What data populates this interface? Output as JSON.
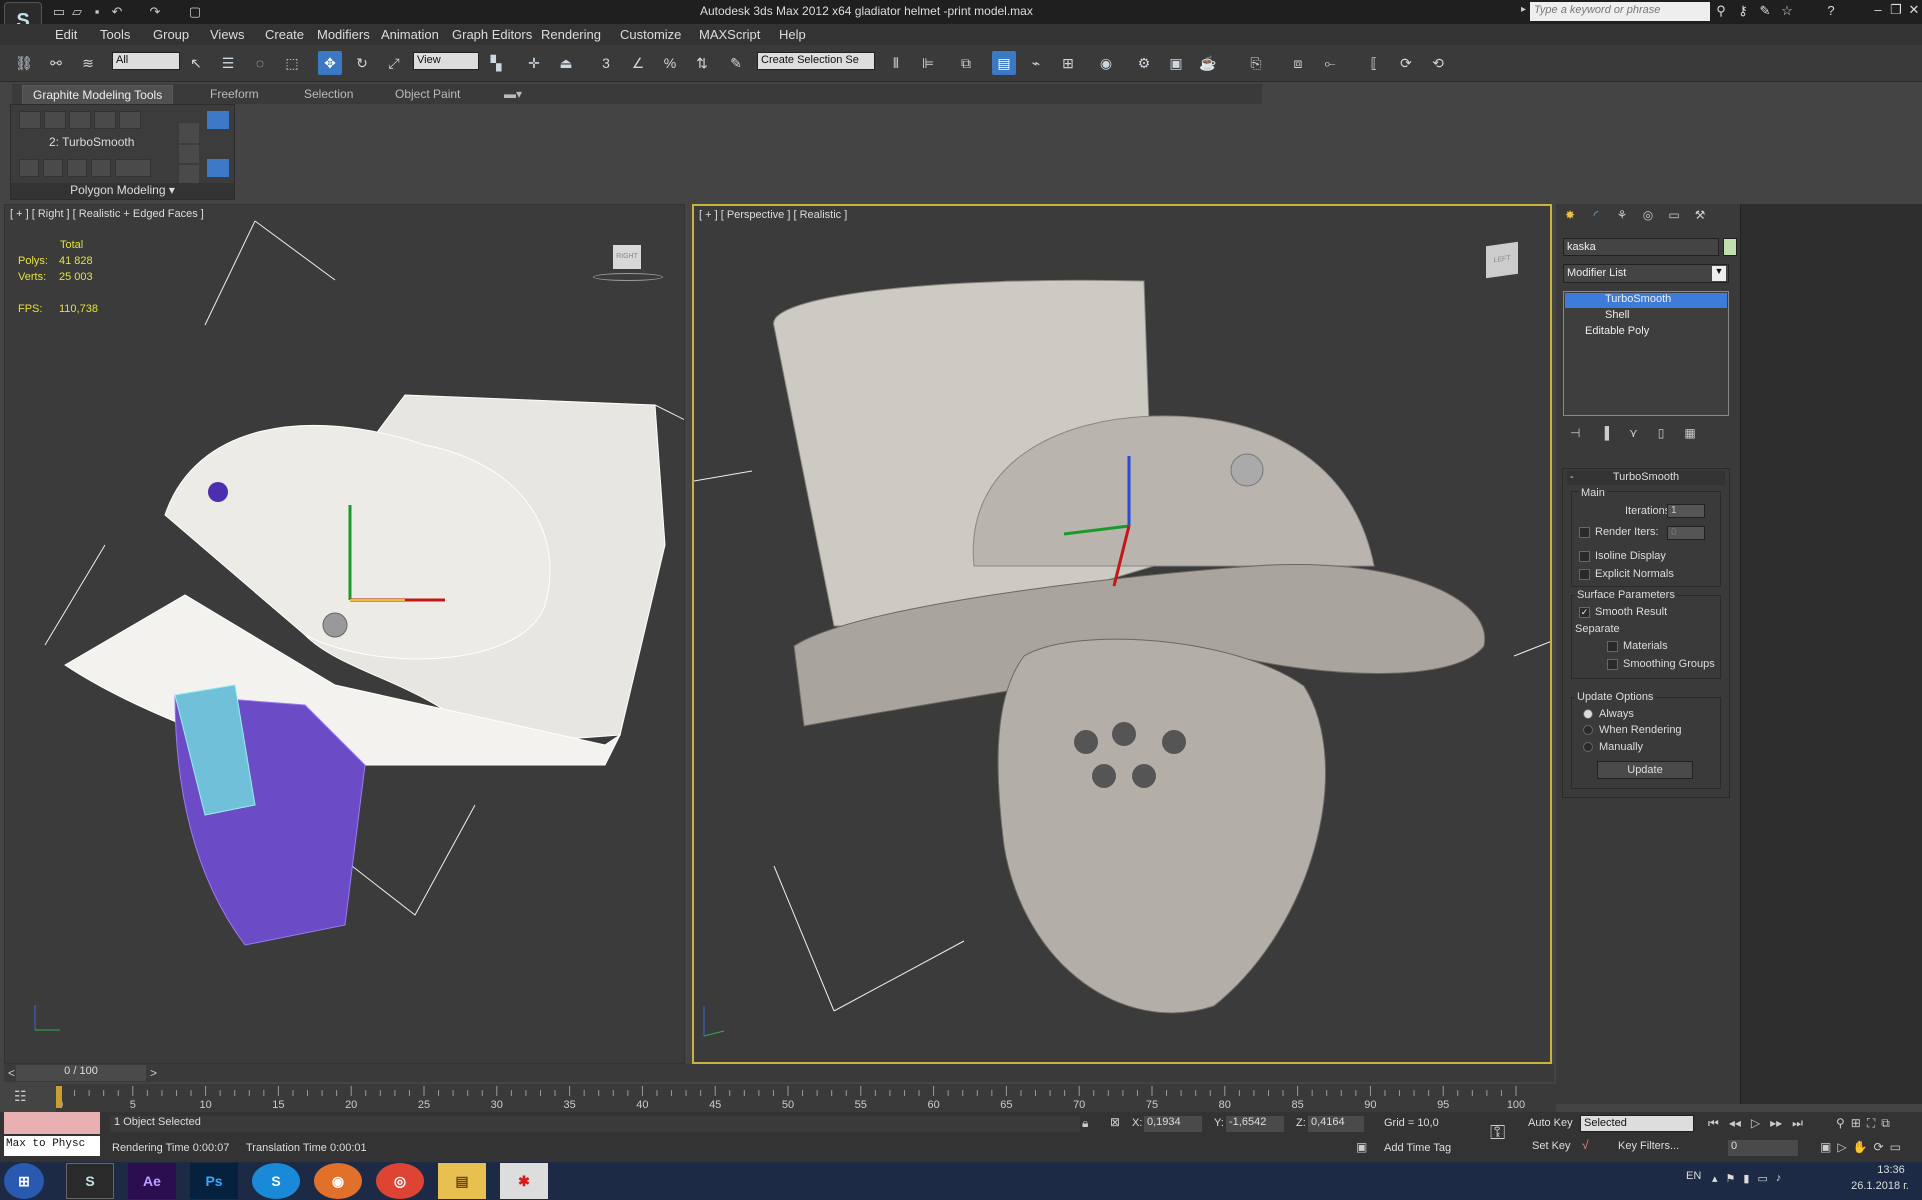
{
  "window": {
    "title": "Autodesk 3ds Max  2012 x64     gladiator helmet -print model.max",
    "search_placeholder": "Type a keyword or phrase"
  },
  "menu": [
    "Edit",
    "Tools",
    "Group",
    "Views",
    "Create",
    "Modifiers",
    "Animation",
    "Graph Editors",
    "Rendering",
    "Customize",
    "MAXScript",
    "Help"
  ],
  "toolbar": {
    "selection_filter": "All",
    "ref_coord": "View",
    "named_sel": "Create Selection Se"
  },
  "ribbon": {
    "tabs": [
      "Graphite Modeling Tools",
      "Freeform",
      "Selection",
      "Object Paint"
    ],
    "panel_title": "2: TurboSmooth",
    "panel_footer": "Polygon Modeling"
  },
  "viewport_left": {
    "label": "[ + ] [ Right ] [ Realistic + Edged Faces ]",
    "total_label": "Total",
    "polys_label": "Polys:",
    "polys": "41 828",
    "verts_label": "Verts:",
    "verts": "25 003",
    "fps_label": "FPS:",
    "fps": "110,738",
    "cube": "RIGHT"
  },
  "viewport_right": {
    "label": "[ + ] [ Perspective ] [ Realistic ]",
    "cube": "LEFT"
  },
  "command_panel": {
    "object_name": "kaska",
    "modifier_list": "Modifier List",
    "stack": [
      "TurboSmooth",
      "Shell",
      "Editable Poly"
    ],
    "rollout_title": "TurboSmooth",
    "main": "Main",
    "iterations_label": "Iterations:",
    "iterations": "1",
    "render_iters_label": "Render Iters:",
    "render_iters": "0",
    "isoline": "Isoline Display",
    "explicit": "Explicit Normals",
    "surface_params": "Surface Parameters",
    "smooth_result": "Smooth Result",
    "separate": "Separate",
    "materials": "Materials",
    "smoothing_groups": "Smoothing Groups",
    "update_options": "Update Options",
    "always": "Always",
    "when_rendering": "When Rendering",
    "manually": "Manually",
    "update_button": "Update"
  },
  "timeline": {
    "frame": "0 / 100",
    "ticks": [
      "0",
      "5",
      "10",
      "15",
      "20",
      "25",
      "30",
      "35",
      "40",
      "45",
      "50",
      "55",
      "60",
      "65",
      "70",
      "75",
      "80",
      "85",
      "90",
      "95",
      "100"
    ]
  },
  "status": {
    "script_listener": "Max to Physc",
    "selection": "1 Object Selected",
    "rendering_time": "Rendering Time  0:00:07",
    "translation_time": "Translation Time  0:00:01",
    "x_label": "X:",
    "x": "0,1934",
    "y_label": "Y:",
    "y": "-1,6542",
    "z_label": "Z:",
    "z": "0,4164",
    "grid": "Grid = 10,0",
    "add_time_tag": "Add Time Tag",
    "auto_key": "Auto Key",
    "set_key": "Set Key",
    "key_mode": "Selected",
    "key_filters": "Key Filters...",
    "frame_field": "0"
  },
  "taskbar": {
    "lang": "EN",
    "time": "13:36",
    "date": "26.1.2018 г."
  }
}
